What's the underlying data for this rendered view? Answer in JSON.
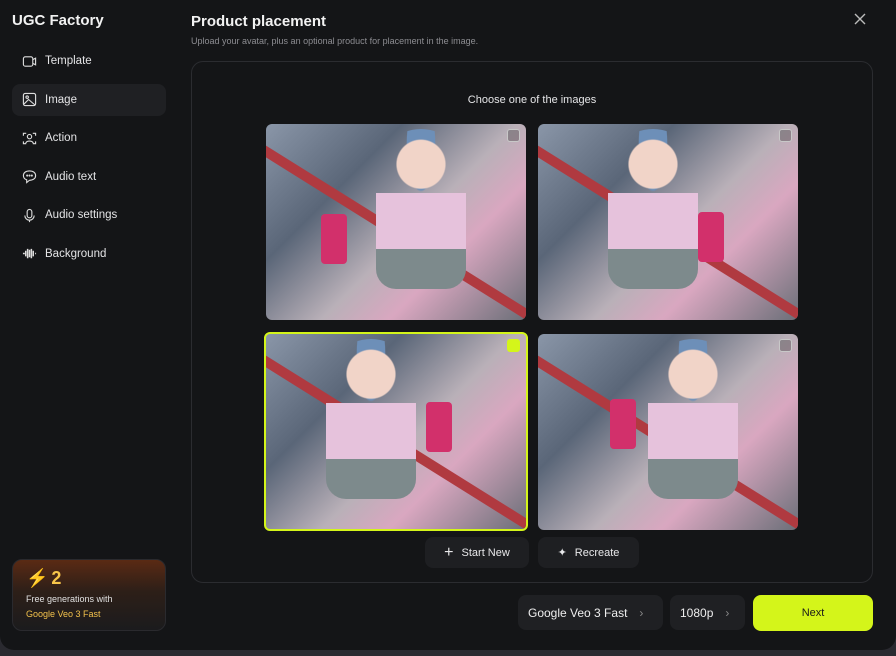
{
  "app": {
    "title": "UGC Factory"
  },
  "nav": [
    {
      "label": "Template",
      "icon": "video-icon"
    },
    {
      "label": "Image",
      "icon": "image-icon"
    },
    {
      "label": "Action",
      "icon": "person-scan-icon"
    },
    {
      "label": "Audio text",
      "icon": "chat-icon"
    },
    {
      "label": "Audio settings",
      "icon": "microphone-icon"
    },
    {
      "label": "Background",
      "icon": "waveform-icon"
    }
  ],
  "promo": {
    "count": "2",
    "line1": "Free generations with",
    "line2": "Google Veo 3 Fast"
  },
  "header": {
    "title": "Product placement",
    "subtitle": "Upload your avatar, plus an optional product for placement in the image."
  },
  "panel": {
    "prompt": "Choose one of the images",
    "images": [
      {
        "selected": false
      },
      {
        "selected": false
      },
      {
        "selected": true
      },
      {
        "selected": false
      }
    ],
    "start_new": "Start New",
    "recreate": "Recreate"
  },
  "footer": {
    "model": "Google Veo 3 Fast",
    "resolution": "1080p",
    "next": "Next"
  },
  "colors": {
    "accent": "#d4f51a",
    "promo": "#f3c24c"
  }
}
